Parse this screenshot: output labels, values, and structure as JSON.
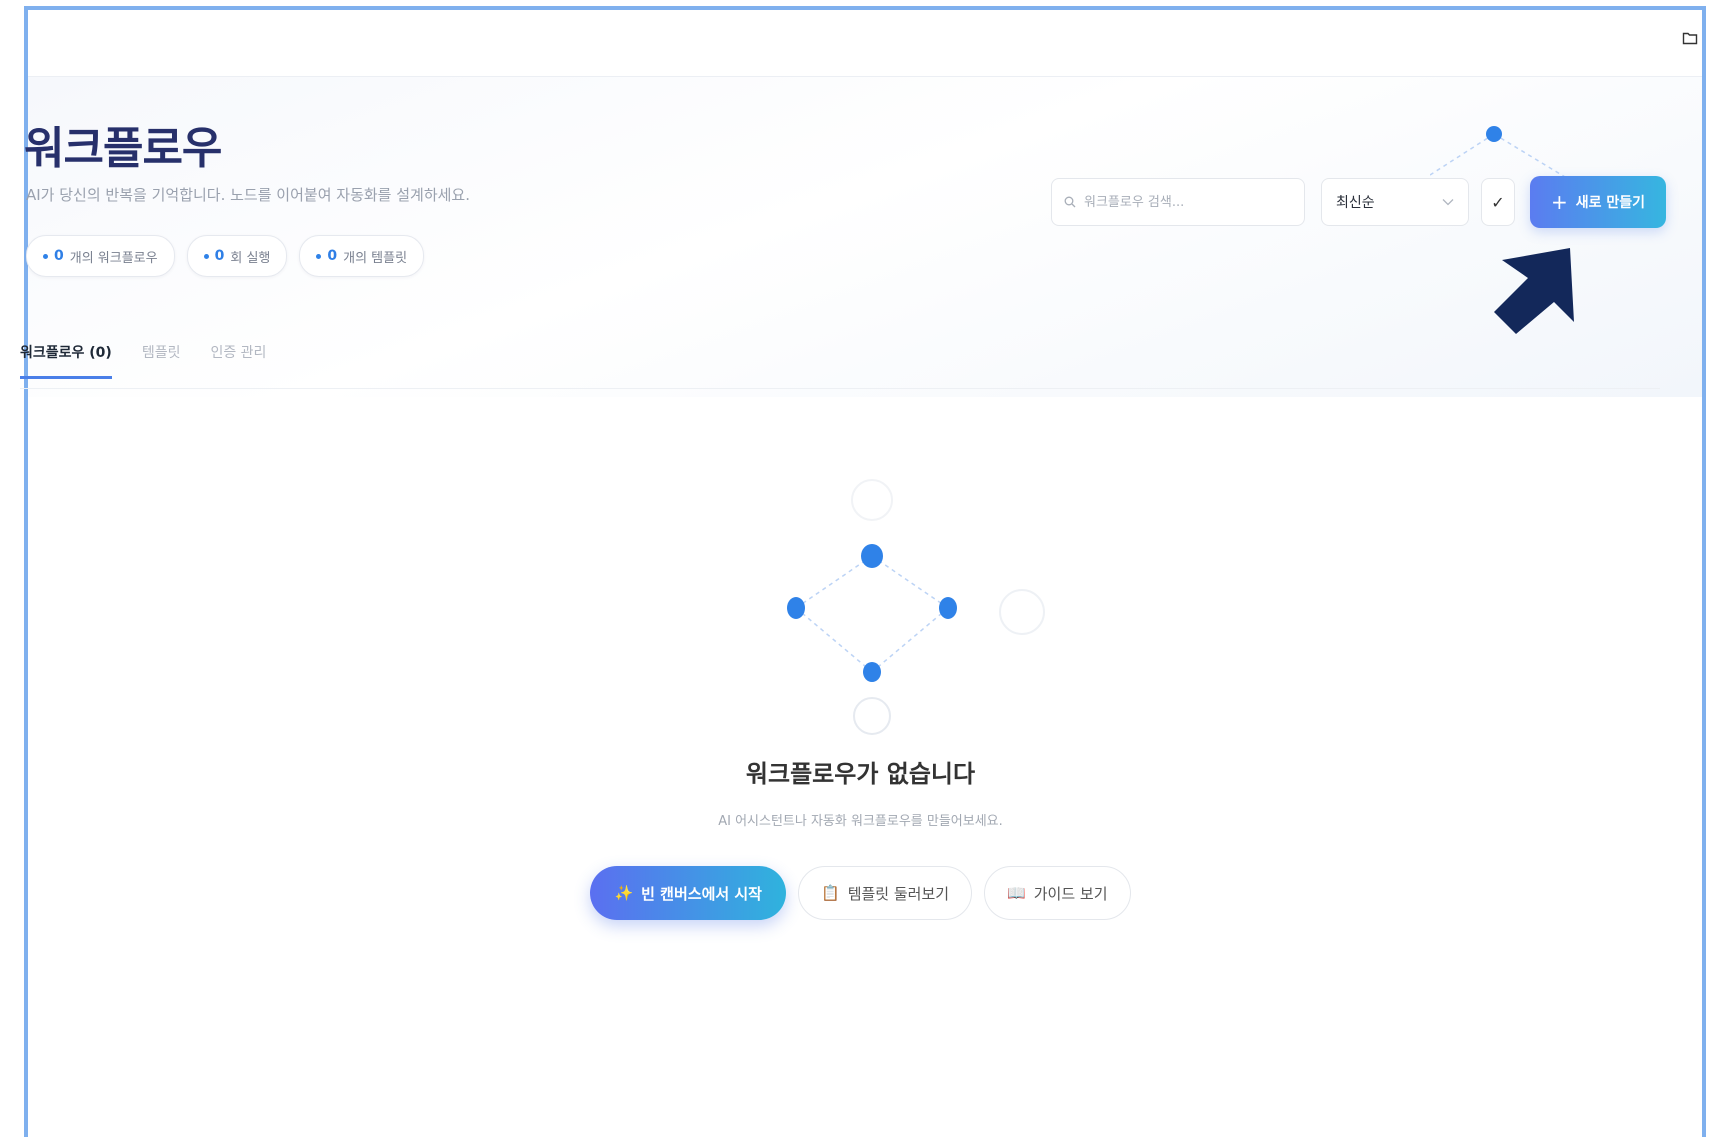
{
  "page": {
    "title": "워크플로우",
    "subtitle": "AI가 당신의 반복을 기억합니다. 노드를 이어붙여 자동화를 설계하세요."
  },
  "stats": [
    {
      "value": "0",
      "label": "개의 워크플로우"
    },
    {
      "value": "0",
      "label": "회 실행"
    },
    {
      "value": "0",
      "label": "개의 템플릿"
    }
  ],
  "toolbar": {
    "search_placeholder": "워크플로우 검색...",
    "sort_value": "최신순",
    "check_glyph": "✓",
    "new_label": "새로 만들기",
    "new_glyph": "+"
  },
  "tabs": [
    {
      "label": "워크플로우 (0)",
      "active": true
    },
    {
      "label": "템플릿",
      "active": false
    },
    {
      "label": "인증 관리",
      "active": false
    }
  ],
  "empty": {
    "title": "워크플로우가 없습니다",
    "subtitle": "AI 어시스턴트나 자동화 워크플로우를 만들어보세요.",
    "primary_label": "빈 캔버스에서 시작",
    "primary_glyph": "✨",
    "templates_label": "템플릿 둘러보기",
    "templates_glyph": "📋",
    "guide_label": "가이드 보기",
    "guide_glyph": "📖"
  },
  "icons": {
    "folder": "folder-icon",
    "search": "search-icon",
    "chevron": "chevron-down-icon",
    "arrow": "pointer-arrow-icon"
  },
  "colors": {
    "accent": "#4a7fe8",
    "title": "#27306b",
    "node": "#2f82e8",
    "arrow": "#13285a",
    "frame": "#7fb0ee"
  }
}
